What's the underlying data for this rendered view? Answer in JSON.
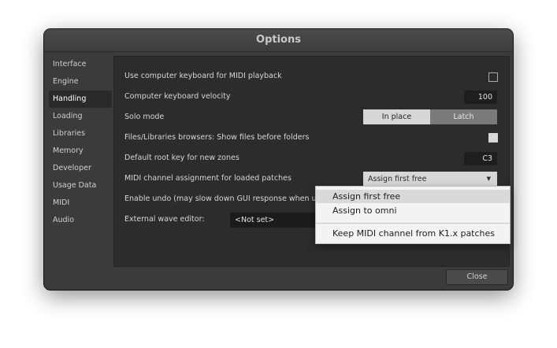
{
  "window": {
    "title": "Options"
  },
  "sidebar": {
    "items": [
      {
        "label": "Interface"
      },
      {
        "label": "Engine"
      },
      {
        "label": "Handling"
      },
      {
        "label": "Loading"
      },
      {
        "label": "Libraries"
      },
      {
        "label": "Memory"
      },
      {
        "label": "Developer"
      },
      {
        "label": "Usage Data"
      },
      {
        "label": "MIDI"
      },
      {
        "label": "Audio"
      }
    ],
    "active": "Handling"
  },
  "settings": {
    "keyboard_midi": {
      "label": "Use computer keyboard for MIDI playback",
      "checked": false
    },
    "keyboard_velocity": {
      "label": "Computer keyboard velocity",
      "value": "100"
    },
    "solo_mode": {
      "label": "Solo mode",
      "options": [
        "In place",
        "Latch"
      ],
      "selected": "In place"
    },
    "files_before_folders": {
      "label": "Files/Libraries browsers: Show files before folders",
      "checked": true
    },
    "root_key": {
      "label": "Default root key for new zones",
      "value": "C3"
    },
    "midi_channel": {
      "label": "MIDI channel assignment for loaded patches",
      "value": "Assign first free",
      "caret": "▼"
    },
    "undo": {
      "label": "Enable undo (may slow down GUI response when using ve"
    },
    "wave_editor": {
      "label": "External wave editor:",
      "value": "<Not set>"
    }
  },
  "popup": {
    "items": [
      {
        "label": "Assign first free"
      },
      {
        "label": "Assign to omni"
      },
      {
        "label": "Keep MIDI channel from K1.x patches"
      }
    ],
    "highlighted": "Assign first free"
  },
  "footer": {
    "close_label": "Close"
  }
}
